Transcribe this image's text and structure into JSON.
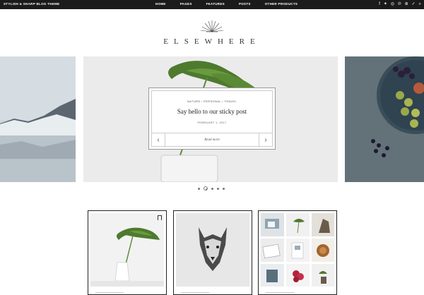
{
  "topbar": {
    "tagline": "STYLISH & SHARP BLOG THEME",
    "nav": [
      "HOME",
      "PAGES",
      "FEATURES",
      "POSTS",
      "OTHER PRODUCTS"
    ],
    "social_icons": [
      "facebook-icon",
      "twitter-icon",
      "instagram-icon",
      "pinterest-icon",
      "dribbble-icon",
      "vimeo-icon",
      "search-icon"
    ]
  },
  "logo": {
    "text": "ELSEWHERE"
  },
  "slider": {
    "categories": "NATURE / PERSONAL / TRAVEL",
    "title": "Say hello to our sticky post",
    "date": "FEBRUARY 1, 2017",
    "read_more": "Read more",
    "dots_count": 5,
    "active_dot": 2
  },
  "grid": {
    "tiles": [
      {
        "image": "monstera-leaf-vase"
      },
      {
        "image": "wolf-sketch"
      },
      {
        "image": "photo-collage"
      }
    ]
  },
  "colors": {
    "topbar": "#1b1b1b",
    "text": "#222222",
    "accent": "#777777"
  }
}
